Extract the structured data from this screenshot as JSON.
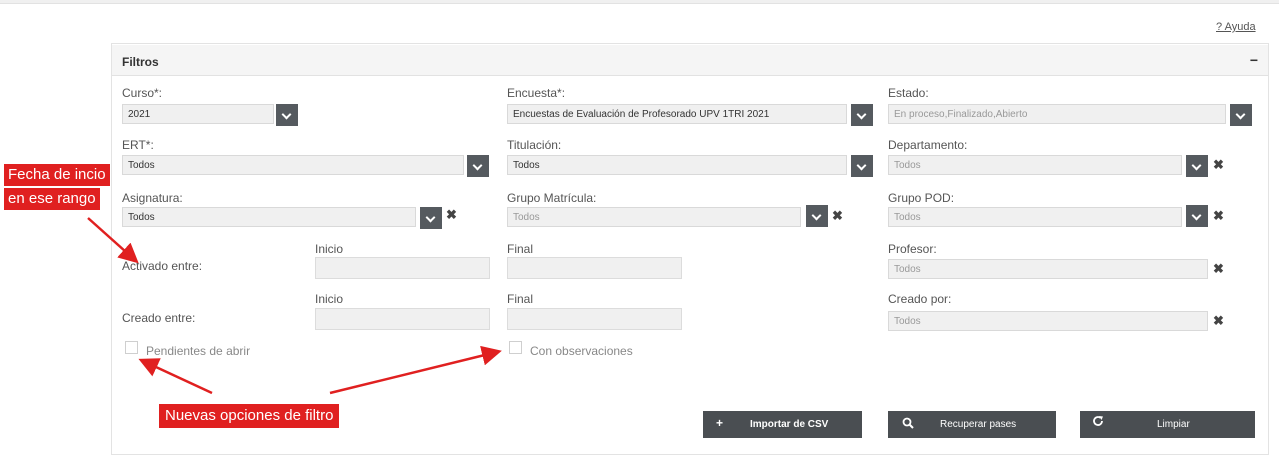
{
  "header": {
    "help_link": "? Ayuda"
  },
  "panel": {
    "title": "Filtros",
    "collapse_symbol": "−"
  },
  "filters": {
    "curso": {
      "label": "Curso*:",
      "value": "2021"
    },
    "encuesta": {
      "label": "Encuesta*:",
      "value": "Encuestas de Evaluación de Profesorado UPV 1TRI 2021"
    },
    "estado": {
      "label": "Estado:",
      "value": "En proceso,Finalizado,Abierto"
    },
    "ert": {
      "label": "ERT*:",
      "value": "Todos"
    },
    "titulacion": {
      "label": "Titulación:",
      "value": "Todos"
    },
    "departamento": {
      "label": "Departamento:",
      "value": "Todos"
    },
    "asignatura": {
      "label": "Asignatura:",
      "value": "Todos"
    },
    "grupo_matricula": {
      "label": "Grupo Matrícula:",
      "value": "Todos"
    },
    "grupo_pod": {
      "label": "Grupo POD:",
      "value": "Todos"
    },
    "activado": {
      "label": "Activado entre:",
      "start_label": "Inicio",
      "end_label": "Final",
      "start_value": "",
      "end_value": ""
    },
    "profesor": {
      "label": "Profesor:",
      "value": "Todos"
    },
    "creado": {
      "label": "Creado entre:",
      "start_label": "Inicio",
      "end_label": "Final",
      "start_value": "",
      "end_value": ""
    },
    "creado_por": {
      "label": "Creado por:",
      "value": "Todos"
    },
    "pendientes": {
      "label": "Pendientes de abrir",
      "checked": false
    },
    "observaciones": {
      "label": "Con observaciones",
      "checked": false
    }
  },
  "actions": {
    "importar": {
      "icon": "+",
      "label": "Importar de CSV"
    },
    "recuperar": {
      "icon": "search-icon",
      "label": "Recuperar pases"
    },
    "limpiar": {
      "icon": "refresh-icon",
      "label": "Limpiar"
    }
  },
  "annotations": {
    "callout_fecha_line1": "Fecha de incio",
    "callout_fecha_line2": "en ese rango",
    "callout_nuevas": "Nuevas opciones de filtro",
    "color": "#e02020"
  },
  "colors": {
    "button_bg": "#4a4e52",
    "field_bg": "#f0f0f0",
    "dropdown_bg": "#555a5f"
  }
}
